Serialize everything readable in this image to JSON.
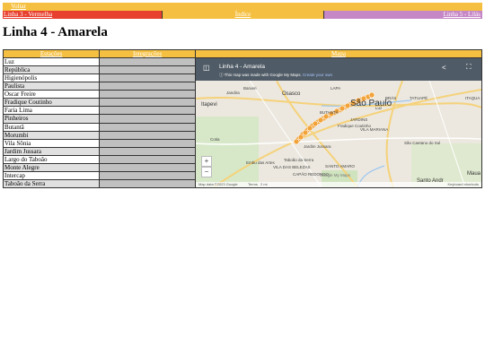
{
  "nav": {
    "back": "Voltar",
    "line_prev": "Linha 3 - Vermelha",
    "index": "Índice",
    "line_next": "Linha 5 - Lilás"
  },
  "page": {
    "title": "Linha 4 - Amarela"
  },
  "table": {
    "headers": [
      "Estações",
      "Integrações",
      "Mapa"
    ],
    "stations": [
      "Luz",
      "República",
      "Higienópolis",
      "Paulista",
      "Oscar Freire",
      "Fradique Coutinho",
      "Faria Lima",
      "Pinheiros",
      "Butantã",
      "Morumbi",
      "Vila Sônia",
      "Jardim Jussara",
      "Largo do Taboão",
      "Monte Alegre",
      "Intercap",
      "Taboão da Serra"
    ]
  },
  "map": {
    "title": "Linha 4 - Amarela",
    "info_text": "This map was made with Google My Maps.",
    "info_link": "Create your own",
    "labels": {
      "sao_paulo": "São Paulo",
      "osasco": "Osasco",
      "itapevi": "Itapevi",
      "barueri": "Barueri",
      "jandira": "Jandira",
      "butanta": "BUTANTÃ",
      "jardins": "JARDINS",
      "vila_mariana": "VILA MARIANA",
      "bras": "BRÁS",
      "tatuape": "TATUAPÉ",
      "lapa": "LAPA",
      "cotia": "Cotia",
      "embu": "Embu das Artes",
      "taboao": "Taboão da Serra",
      "santo_amaro": "SANTO AMARO",
      "sao_caetano": "São Caetano do Sul",
      "capao": "CAPÃO REDONDO",
      "vila_das_belezas": "VILA DAS BELEZAS",
      "jardim_jussara": "Jardim Jussara",
      "fradique": "Fradique Coutinho",
      "luz": "Luz",
      "itaqua": "ITAQUA",
      "santo_andre": "Santo Andr",
      "maua": "Maua",
      "google": "Google My Maps"
    },
    "footer": {
      "data": "Map data ©2023 Google",
      "terms": "Terms",
      "scale": "2 mi",
      "shortcuts": "Keyboard shortcuts"
    },
    "zoom_in": "+",
    "zoom_out": "−"
  }
}
